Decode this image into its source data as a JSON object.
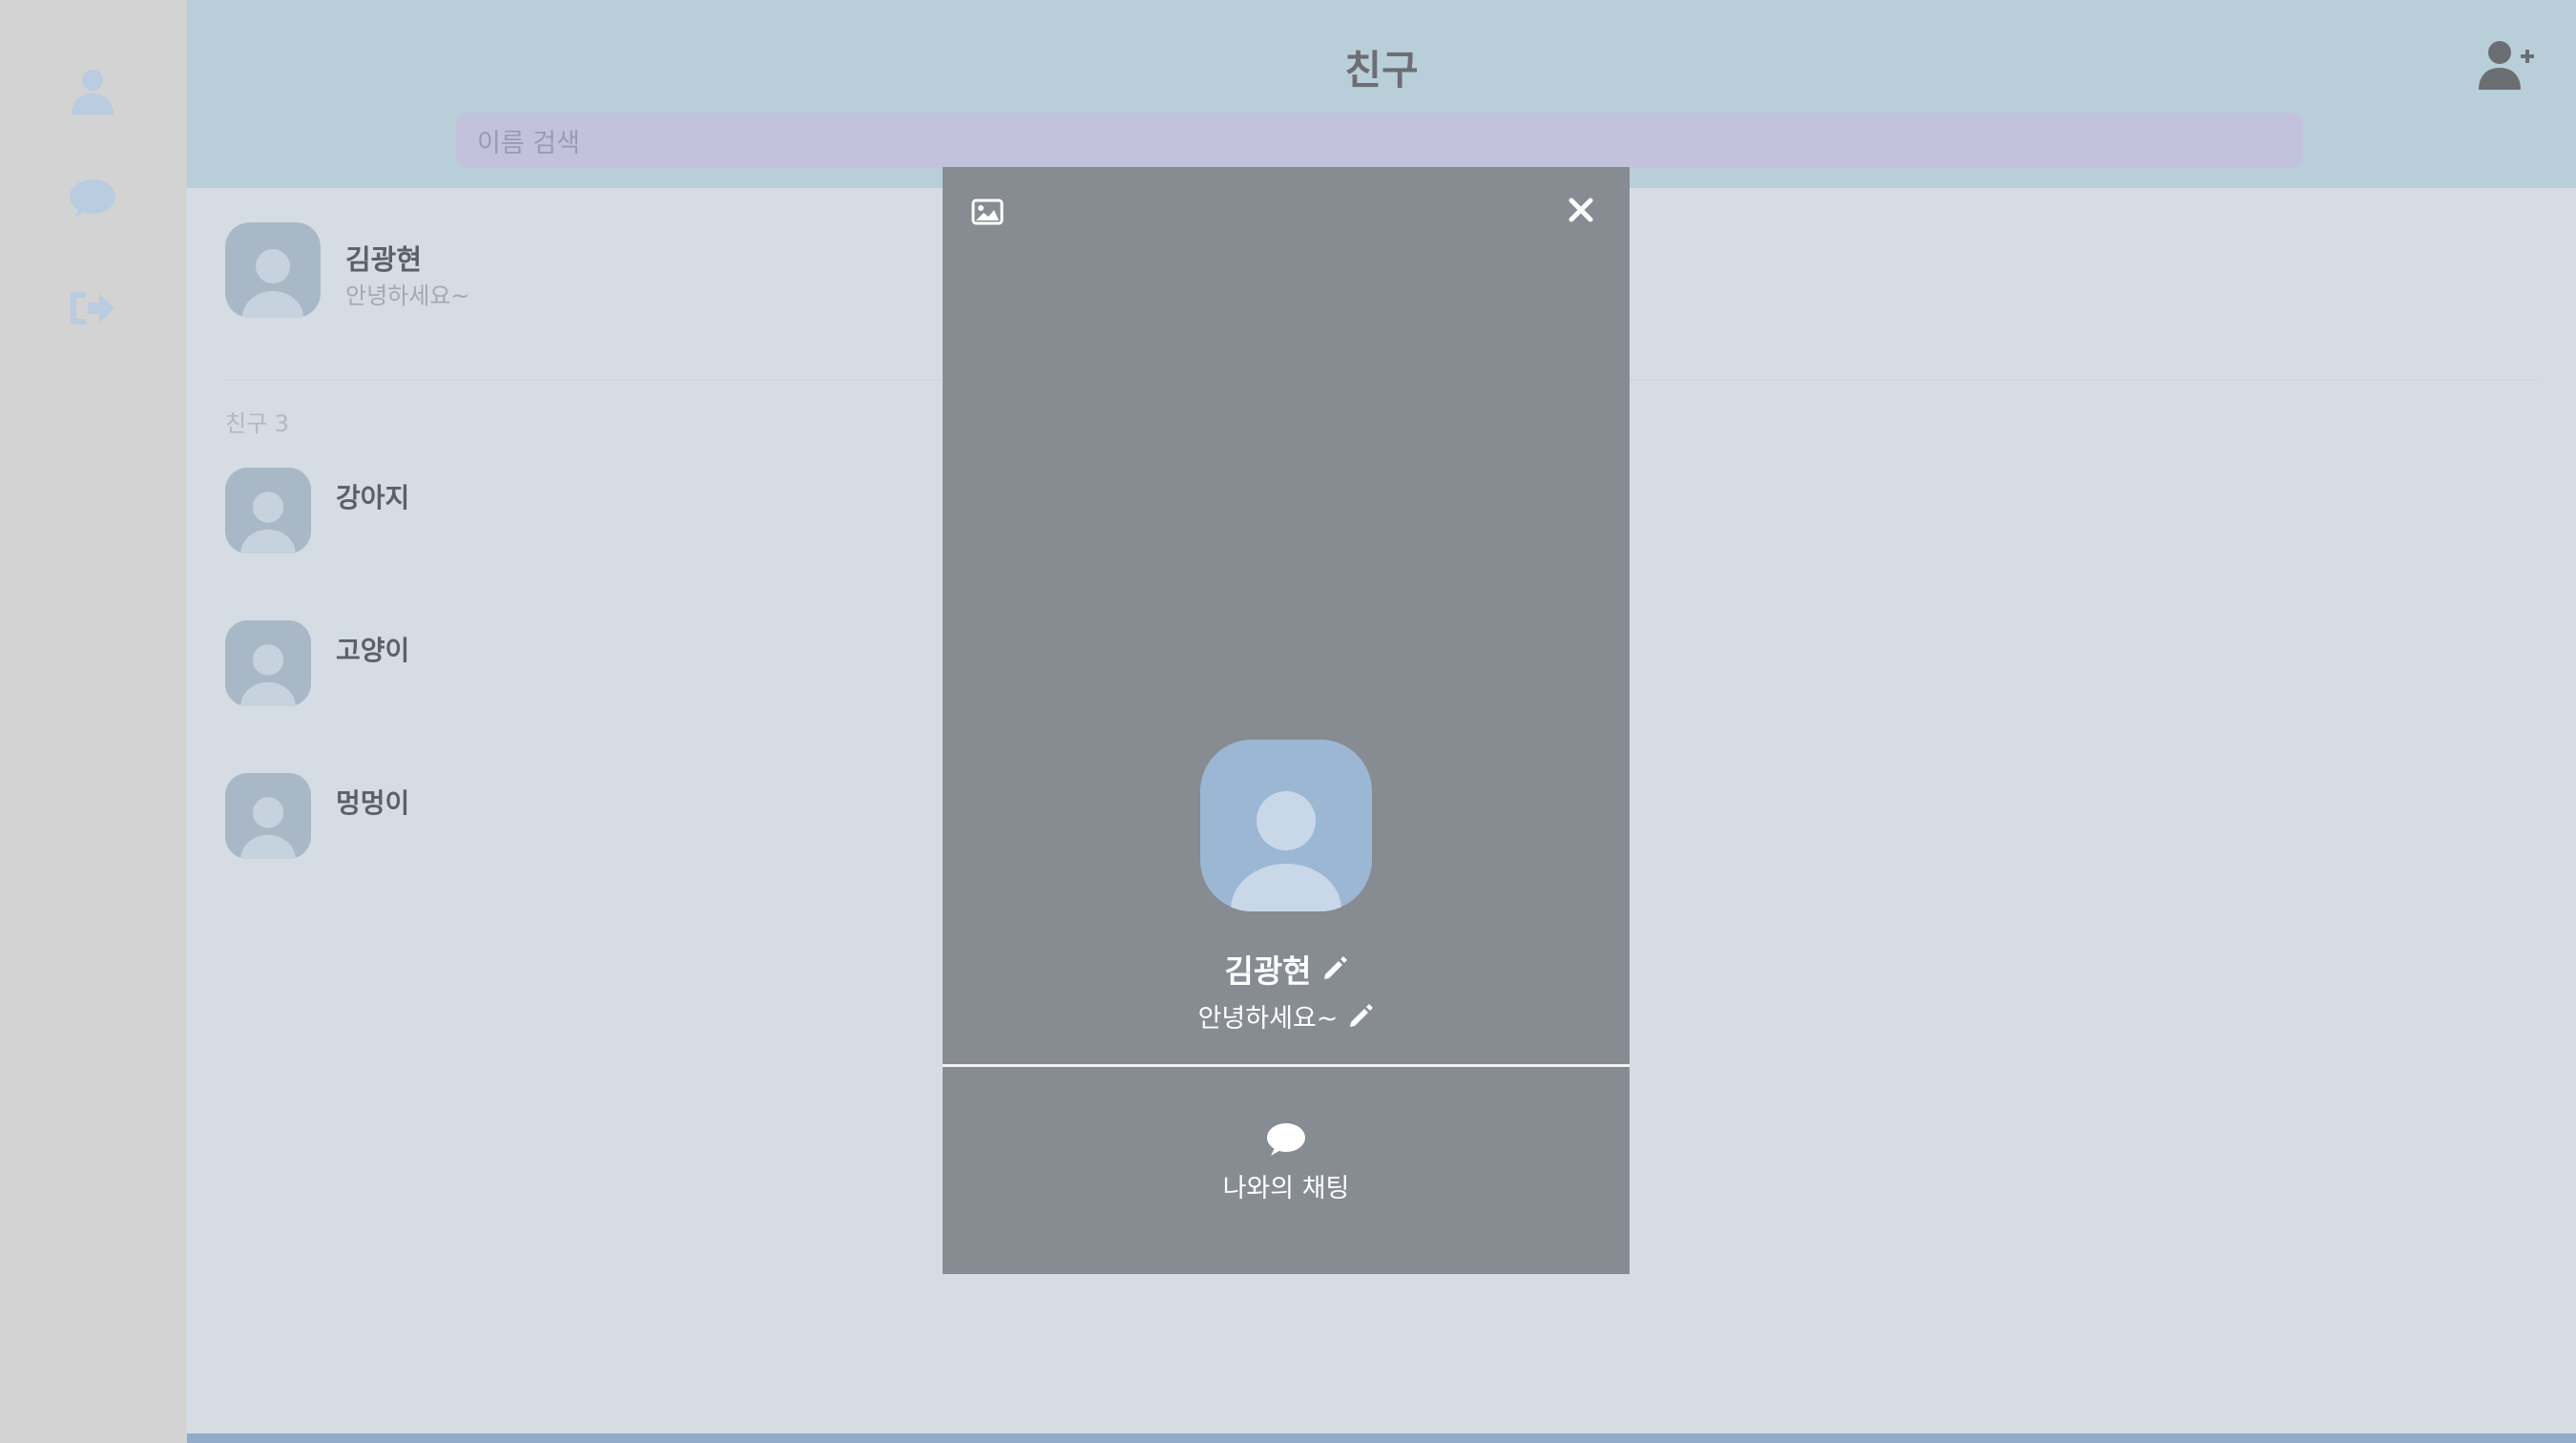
{
  "sidebar": {
    "icons": [
      "user-icon",
      "chat-bubble-icon",
      "sign-out-icon"
    ],
    "icon_color": "#b9cce0"
  },
  "header": {
    "title": "친구",
    "search_placeholder": "이름 검색",
    "add_friend_icon": "user-plus-icon"
  },
  "me": {
    "name": "김광현",
    "status": "안녕하세요~"
  },
  "friends_section": {
    "label": "친구 3",
    "items": [
      {
        "name": "강아지"
      },
      {
        "name": "고양이"
      },
      {
        "name": "멍멍이"
      }
    ]
  },
  "modal": {
    "top_left_icon": "image-icon",
    "close_icon": "close-icon",
    "name": "김광현",
    "status": "안녕하세요~",
    "chat_label": "나와의 채팅",
    "chat_icon": "chat-bubble-icon",
    "background": "#878b92"
  },
  "colors": {
    "header": "#b8cfda",
    "search": "#c3c2dc",
    "page": "#d5dce3",
    "sidebar": "#d3d3d3",
    "modal_avatar": "#9cb7d4"
  }
}
